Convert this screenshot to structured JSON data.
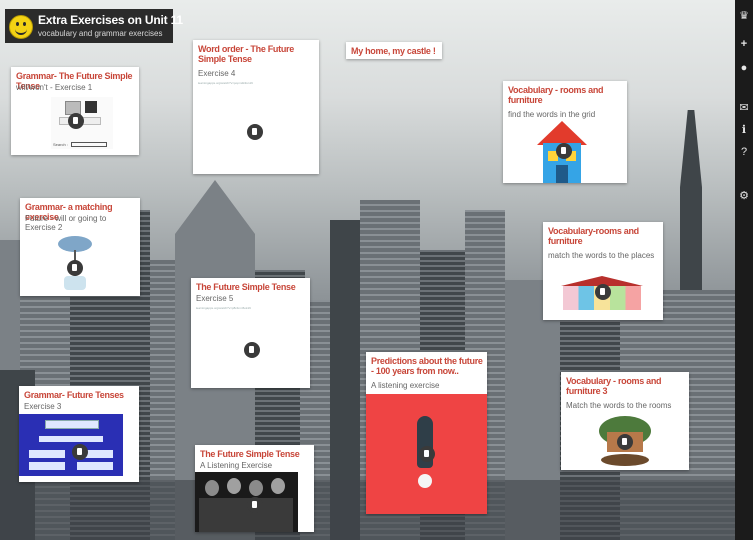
{
  "header": {
    "title": "Extra Exercises on Unit 11",
    "subtitle": "vocabulary and grammar exercises"
  },
  "cards": {
    "c1": {
      "title": "Grammar- The Future Simple Tense",
      "subtitle": "will/won't - Exercise 1",
      "thumb_text": "Search :"
    },
    "c2": {
      "title": "Word order - The Future Simple Tense",
      "subtitle": "Exercise 4",
      "link": "learningapps.org/watch?v=popm2k3sn19"
    },
    "c3": {
      "title": "My home, my castle !"
    },
    "c4": {
      "title": "Vocabulary - rooms and furniture",
      "subtitle": "find the words in the grid"
    },
    "c5": {
      "title": "Grammar- a matching exercise",
      "subtitle": "Future - will or going to Exercise 2"
    },
    "c6": {
      "title": "The Future Simple Tense",
      "subtitle": "Exercise 5",
      "link": "learningapps.org/watch?v=p8c4mn5ok19"
    },
    "c7": {
      "title": "Vocabulary-rooms and furniture",
      "subtitle": "match the words to the places"
    },
    "c8": {
      "title": "Predictions about the future - 100 years from now..",
      "subtitle": "A listening exercise"
    },
    "c9": {
      "title": "Grammar- Future Tenses",
      "subtitle": "Exercise 3"
    },
    "c10": {
      "title": "Vocabulary - rooms and furniture 3",
      "subtitle": "Match the words to the rooms"
    },
    "c11": {
      "title": "The Future Simple Tense",
      "subtitle": "A Listening Exercise"
    }
  },
  "sidebar": {
    "icons": [
      "crown-icon",
      "plus-icon",
      "user-icon",
      "mail-icon",
      "info-icon",
      "help-icon",
      "gear-icon"
    ]
  },
  "colors": {
    "title_red": "#c8473a",
    "sidebar": "#1b1b1b",
    "header": "#2b2b2b",
    "prediction_card": "#ef4444"
  }
}
